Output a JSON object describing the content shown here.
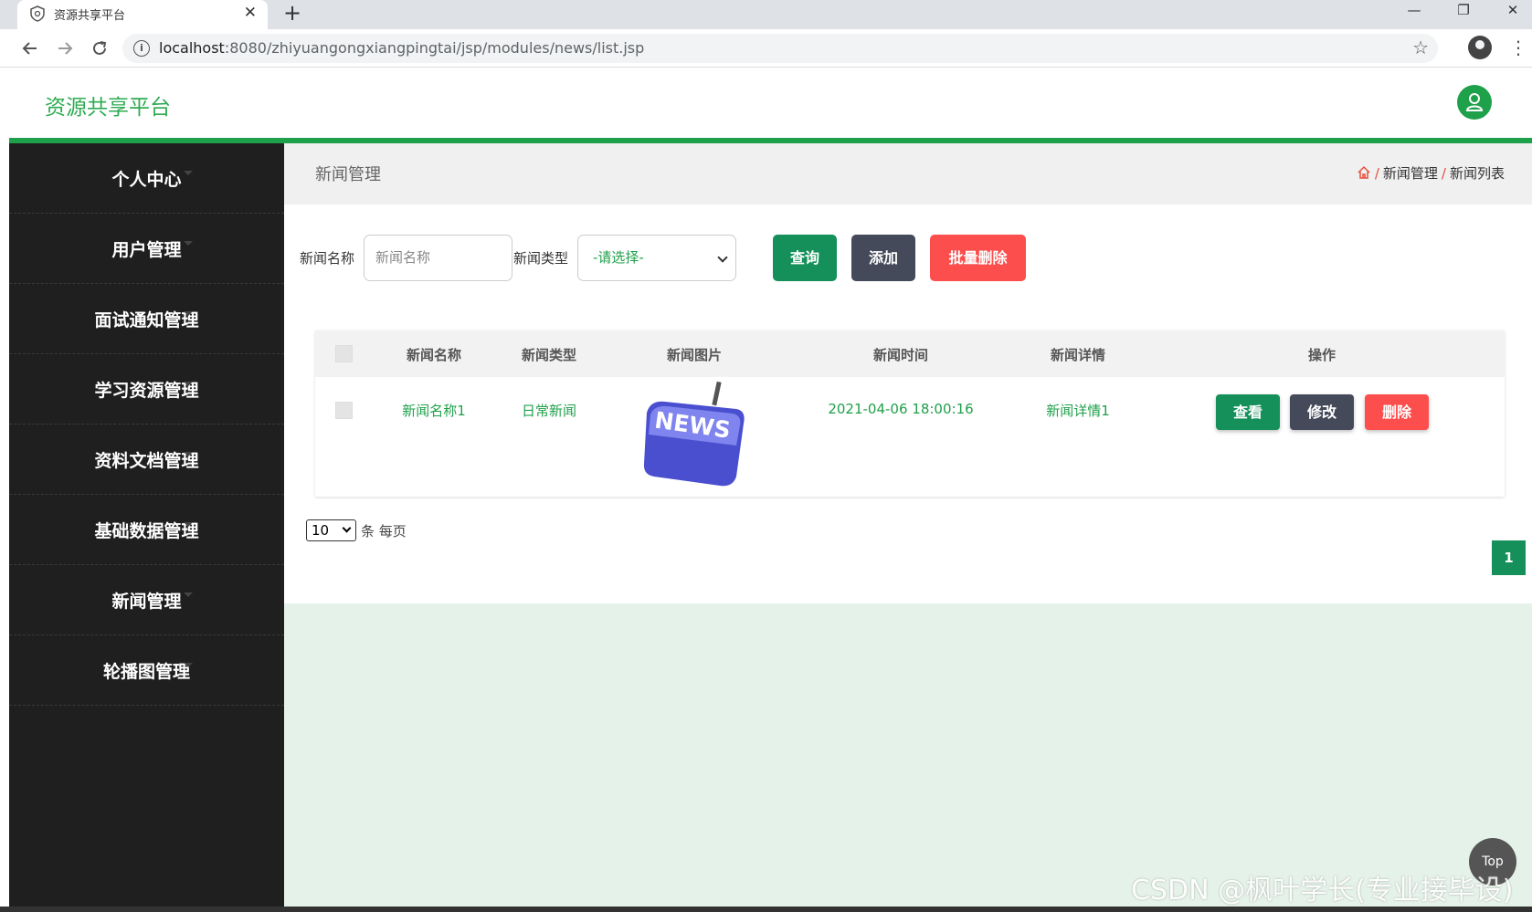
{
  "browser": {
    "tab_title": "资源共享平台",
    "tab_close": "✕",
    "new_tab": "+",
    "url_host": "localhost",
    "url_rest": ":8080/zhiyuangongxiangpingtai/jsp/modules/news/list.jsp",
    "minimize": "—",
    "restore": "❐",
    "close": "✕"
  },
  "header": {
    "site_title": "资源共享平台"
  },
  "sidebar": {
    "items": [
      {
        "label": "个人中心"
      },
      {
        "label": "用户管理"
      },
      {
        "label": "面试通知管理"
      },
      {
        "label": "学习资源管理"
      },
      {
        "label": "资料文档管理"
      },
      {
        "label": "基础数据管理"
      },
      {
        "label": "新闻管理"
      },
      {
        "label": "轮播图管理"
      }
    ]
  },
  "page": {
    "title": "新闻管理",
    "breadcrumb": [
      "新闻管理",
      "新闻列表"
    ],
    "breadcrumb_sep": "/"
  },
  "search": {
    "name_label": "新闻名称",
    "name_placeholder": "新闻名称",
    "type_label": "新闻类型",
    "type_value": "-请选择-",
    "query_btn": "查询",
    "add_btn": "添加",
    "batch_delete_btn": "批量删除"
  },
  "table": {
    "headers": [
      "新闻名称",
      "新闻类型",
      "新闻图片",
      "新闻时间",
      "新闻详情",
      "操作"
    ],
    "rows": [
      {
        "name": "新闻名称1",
        "type": "日常新闻",
        "image_label": "NEWS",
        "time": "2021-04-06 18:00:16",
        "detail": "新闻详情1",
        "actions": [
          "查看",
          "修改",
          "删除"
        ]
      }
    ]
  },
  "pager": {
    "page_size": "10",
    "per_page_text": "条 每页",
    "current_page": "1"
  },
  "top_button": "Top",
  "watermark": "CSDN @枫叶学长(专业接毕设)",
  "colors": {
    "brand_green": "#1fa04a",
    "sidebar_bg": "#1f1f1f",
    "danger": "#fd4e4e",
    "dark_btn": "#454a5a"
  }
}
